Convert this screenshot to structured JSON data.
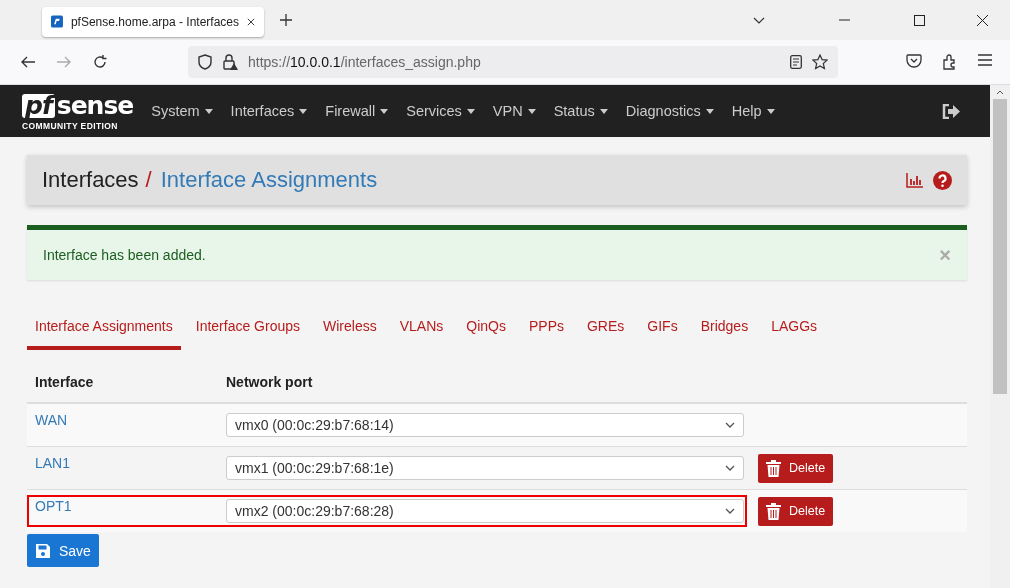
{
  "browser": {
    "tab_title": "pfSense.home.arpa - Interfaces",
    "url_scheme": "https://",
    "url_host": "10.0.0.1",
    "url_path": "/interfaces_assign.php"
  },
  "logo": {
    "mark": "pf",
    "name": "sense",
    "edition": "COMMUNITY EDITION"
  },
  "nav": [
    "System",
    "Interfaces",
    "Firewall",
    "Services",
    "VPN",
    "Status",
    "Diagnostics",
    "Help"
  ],
  "breadcrumb": {
    "section": "Interfaces",
    "separator": "/",
    "page": "Interface Assignments"
  },
  "alert": {
    "message": "Interface has been added.",
    "close": "×"
  },
  "tabs": [
    {
      "label": "Interface Assignments",
      "selected": true
    },
    {
      "label": "Interface Groups",
      "selected": false
    },
    {
      "label": "Wireless",
      "selected": false
    },
    {
      "label": "VLANs",
      "selected": false
    },
    {
      "label": "QinQs",
      "selected": false
    },
    {
      "label": "PPPs",
      "selected": false
    },
    {
      "label": "GREs",
      "selected": false
    },
    {
      "label": "GIFs",
      "selected": false
    },
    {
      "label": "Bridges",
      "selected": false
    },
    {
      "label": "LAGGs",
      "selected": false
    }
  ],
  "table": {
    "columns": [
      "Interface",
      "Network port"
    ],
    "rows": [
      {
        "interface": "WAN",
        "port": "vmx0 (00:0c:29:b7:68:14)",
        "highlighted": false
      },
      {
        "interface": "LAN1",
        "port": "vmx1 (00:0c:29:b7:68:1e)",
        "delete": "Delete",
        "highlighted": false
      },
      {
        "interface": "OPT1",
        "port": "vmx2 (00:0c:29:b7:68:28)",
        "delete": "Delete",
        "highlighted": true
      }
    ]
  },
  "save_button": "Save"
}
